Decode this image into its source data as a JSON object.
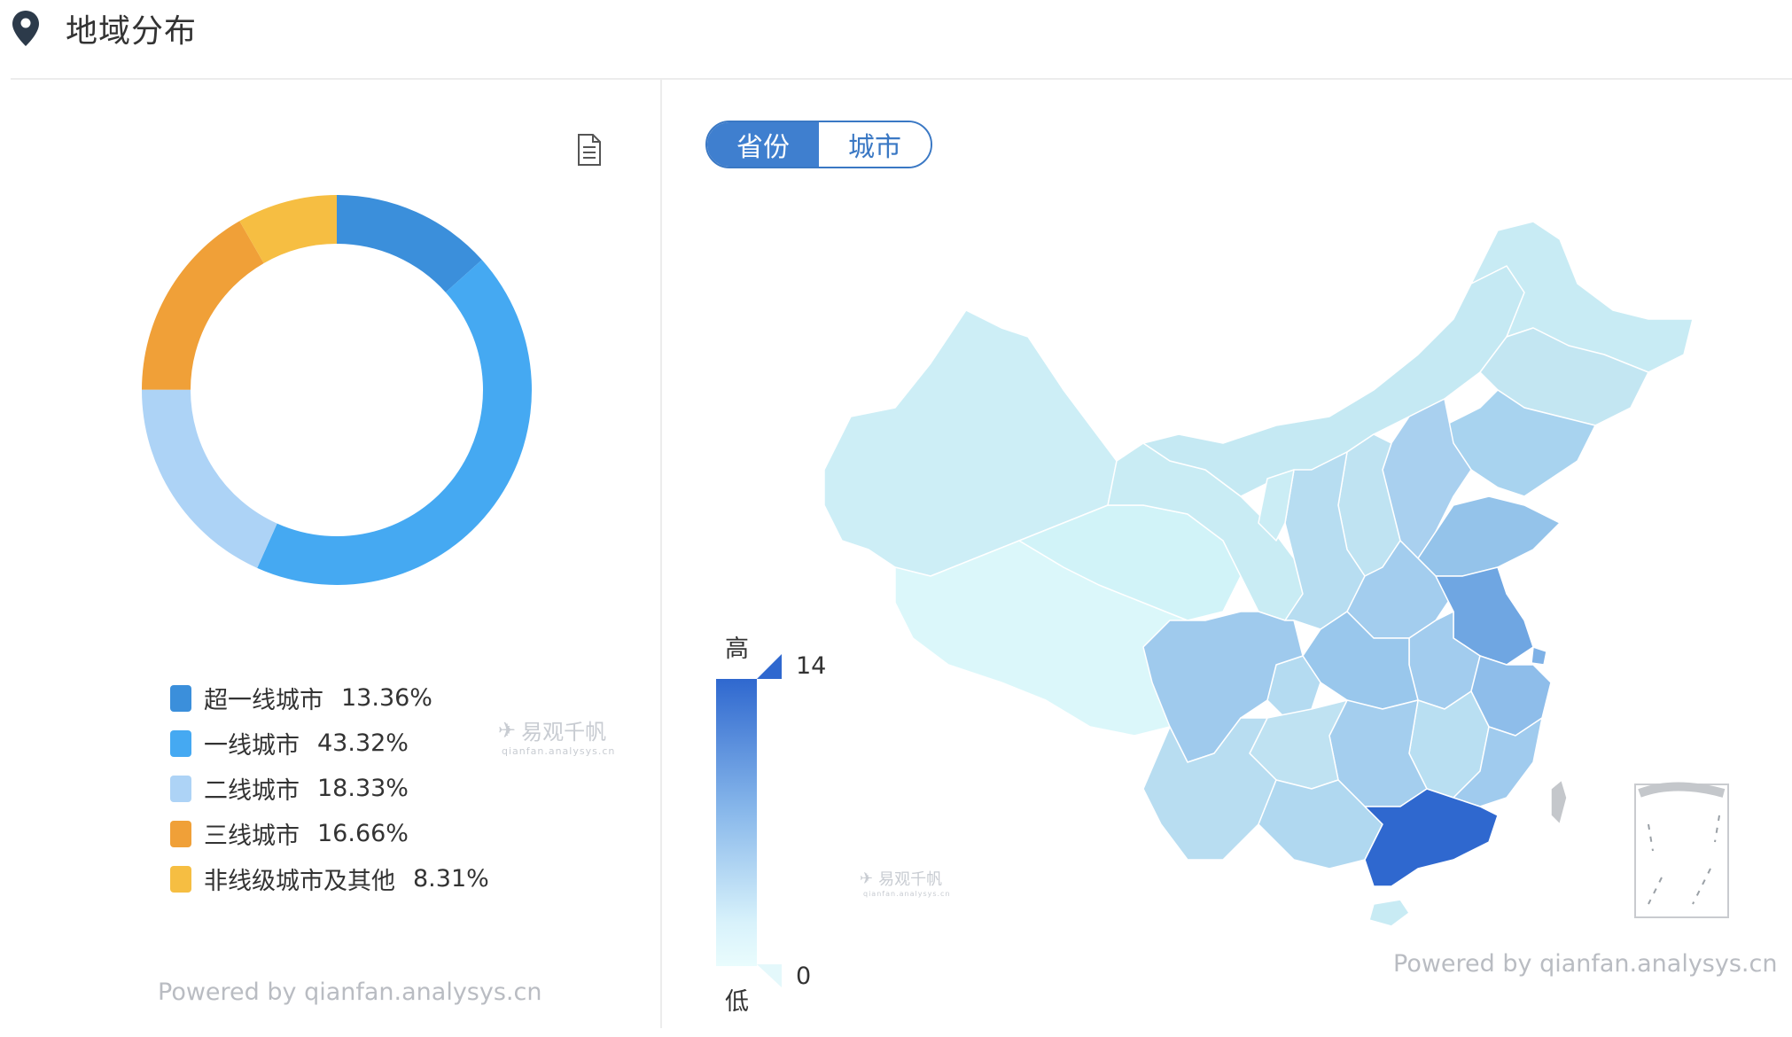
{
  "header": {
    "title": "地域分布",
    "icon": "location-pin-icon"
  },
  "left_panel": {
    "watermark": {
      "brand": "易观千帆",
      "domain": "qianfan.analysys.cn"
    },
    "powered_by": "Powered by qianfan.analysys.cn"
  },
  "right_panel": {
    "toggle": {
      "options": [
        "省份",
        "城市"
      ],
      "selected": "省份"
    },
    "visual_map": {
      "high_label": "高",
      "low_label": "低",
      "max": "14",
      "min": "0",
      "colors": [
        "#2f68cf",
        "#e9fcfd"
      ]
    },
    "watermark": {
      "brand": "易观千帆",
      "domain": "qianfan.analysys.cn"
    },
    "powered_by": "Powered by qianfan.analysys.cn"
  },
  "chart_data": [
    {
      "type": "pie",
      "subtype": "donut",
      "categories": [
        "超一线城市",
        "一线城市",
        "二线城市",
        "三线城市",
        "非线级城市及其他"
      ],
      "values": [
        13.36,
        43.32,
        18.33,
        16.66,
        8.31
      ],
      "labels": [
        "13.36%",
        "43.32%",
        "18.33%",
        "16.66%",
        "8.31%"
      ],
      "colors": [
        "#3b8fdb",
        "#45a9f2",
        "#add3f6",
        "#f0a038",
        "#f6be42"
      ],
      "legend_position": "bottom"
    },
    {
      "type": "heatmap",
      "subtype": "china-province-choropleth",
      "value_range": [
        0,
        14
      ],
      "highest_region": "广东"
    }
  ]
}
